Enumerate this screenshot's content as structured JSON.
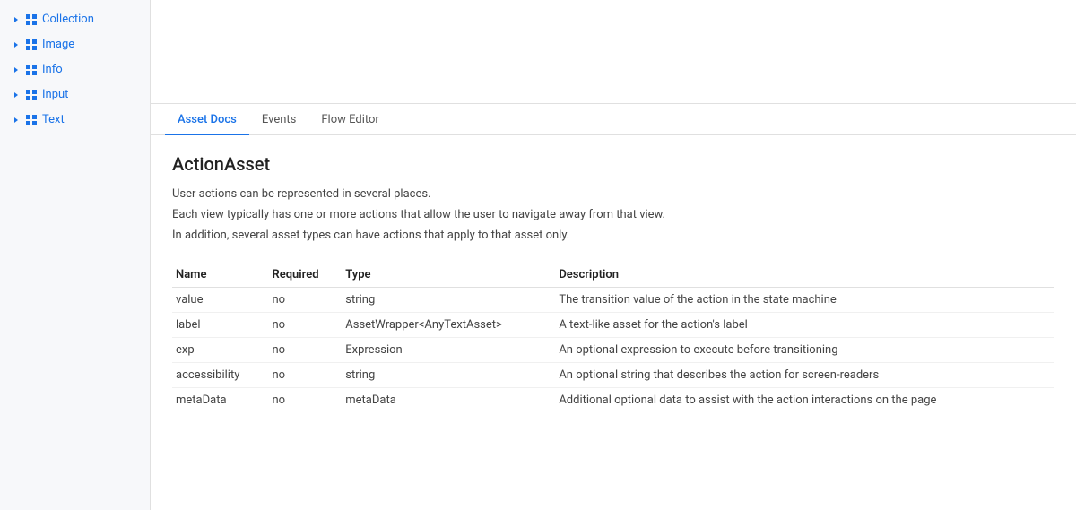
{
  "sidebar": {
    "items": [
      {
        "id": "collection",
        "label": "Collection",
        "hasChevron": true,
        "hasGrid": true
      },
      {
        "id": "image",
        "label": "Image",
        "hasChevron": true,
        "hasGrid": true
      },
      {
        "id": "info",
        "label": "Info",
        "hasChevron": true,
        "hasGrid": true
      },
      {
        "id": "input",
        "label": "Input",
        "hasChevron": true,
        "hasGrid": true
      },
      {
        "id": "text",
        "label": "Text",
        "hasChevron": true,
        "hasGrid": true
      }
    ]
  },
  "tabs": [
    {
      "id": "asset-docs",
      "label": "Asset Docs",
      "active": true
    },
    {
      "id": "events",
      "label": "Events",
      "active": false
    },
    {
      "id": "flow-editor",
      "label": "Flow Editor",
      "active": false
    }
  ],
  "content": {
    "title": "ActionAsset",
    "description_lines": [
      "User actions can be represented in several places.",
      "Each view typically has one or more actions that allow the user to navigate away from that view.",
      "In addition, several asset types can have actions that apply to that asset only."
    ],
    "table": {
      "headers": [
        "Name",
        "Required",
        "Type",
        "Description"
      ],
      "rows": [
        {
          "name": "value",
          "required": "no",
          "type": "string",
          "description": "The transition value of the action in the state machine",
          "type_is_link": false
        },
        {
          "name": "label",
          "required": "no",
          "type": "AssetWrapper<AnyTextAsset>",
          "description": "A text-like asset for the action's label",
          "type_is_link": false
        },
        {
          "name": "exp",
          "required": "no",
          "type": "Expression",
          "description": "An optional expression to execute before transitioning",
          "type_is_link": false
        },
        {
          "name": "accessibility",
          "required": "no",
          "type": "string",
          "description": "An optional string that describes the action for screen-readers",
          "type_is_link": false
        },
        {
          "name": "metaData",
          "required": "no",
          "type": "metaData",
          "description": "Additional optional data to assist with the action interactions on the page",
          "type_is_link": true
        }
      ]
    }
  }
}
